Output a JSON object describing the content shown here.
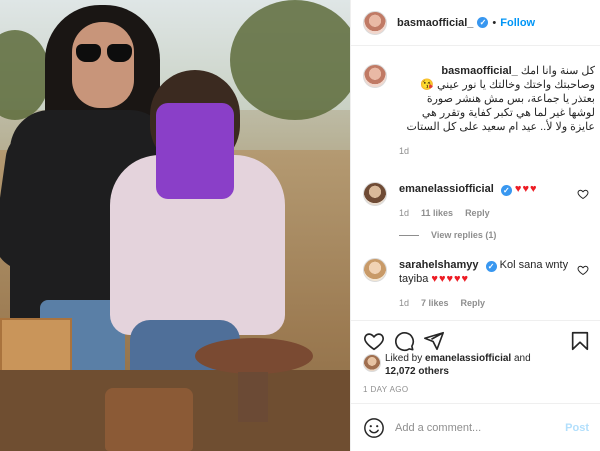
{
  "header": {
    "username": "basmaofficial_",
    "verified_glyph": "✓",
    "separator": "•",
    "follow_label": "Follow"
  },
  "caption": {
    "username": "basmaofficial_",
    "text": "كل سنة وانا امك وصاحبتك واختك وخالتك يا نور عيني 😘 بعتذر يا جماعة، بس مش هنشر صورة لوشها غير لما هي تكبر كفاية وتقرر هي عايزة ولا لأ.. عيد ام سعيد على كل الستات",
    "age": "1d"
  },
  "comments": [
    {
      "username": "emanelassiofficial",
      "text": "♥♥♥",
      "age": "1d",
      "likes": "11 likes",
      "reply": "Reply",
      "view_replies": "View replies (1)"
    },
    {
      "username": "sarahelshamyy",
      "text": "Kol sana wnty tayiba",
      "hearts": "♥♥♥♥♥",
      "age": "1d",
      "likes": "7 likes",
      "reply": "Reply"
    }
  ],
  "actions": {
    "icons": [
      "heart-icon",
      "comment-icon",
      "share-icon",
      "bookmark-icon"
    ]
  },
  "likes_summary": {
    "prefix": "Liked by ",
    "user": "emanelassiofficial",
    "joiner": " and",
    "count": "12,072 others"
  },
  "timestamp": "1 DAY AGO",
  "add_comment": {
    "placeholder": "Add a comment...",
    "post_label": "Post"
  },
  "colors": {
    "accent": "#0095f6",
    "verified": "#3897f0",
    "heart": "#ed1c24",
    "face_blur": "#8a3fc8"
  }
}
